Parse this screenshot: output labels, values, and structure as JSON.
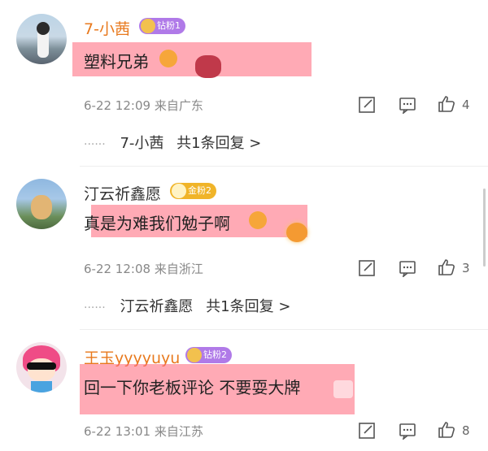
{
  "comments": [
    {
      "username": "7-小茜",
      "badge": "钻粉1",
      "text": "塑料兄弟",
      "time": "6-22 12:09",
      "location": "来自广东",
      "likes": "4",
      "reply_prefix": "······",
      "reply_user": "7-小茜",
      "reply_count": "共1条回复 >"
    },
    {
      "username": "汀云祈鑫愿",
      "badge": "金粉2",
      "text": "真是为难我们勉子啊",
      "time": "6-22 12:08",
      "location": "来自浙江",
      "likes": "3",
      "reply_prefix": "······",
      "reply_user": "汀云祈鑫愿",
      "reply_count": "共1条回复 >"
    },
    {
      "username": "王玉yyyyuyu",
      "badge": "钻粉2",
      "text": "回一下你老板评论 不要耍大牌",
      "time": "6-22 13:01",
      "location": "来自江苏",
      "likes": "8"
    }
  ],
  "colors": {
    "username_orange": "#e8791d",
    "username_dark": "#333333",
    "badge_purple": "#b07ae8",
    "badge_gold": "#f0b429",
    "highlight": "#ff6478"
  },
  "icons": [
    "edit-icon",
    "comment-icon",
    "like-icon"
  ]
}
